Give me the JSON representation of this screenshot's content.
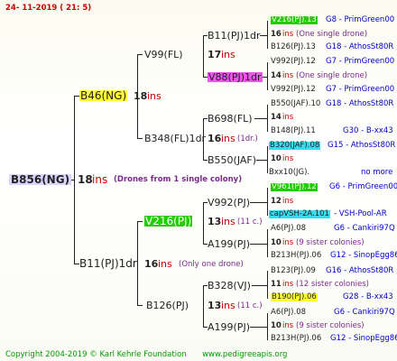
{
  "header": {
    "date": "24- 11-2019 ( 21: 5)"
  },
  "root": {
    "id": "B856(NG)",
    "ins_num": "18",
    "ins_word": "ins",
    "note": "(Drones from 1 single colony)"
  },
  "level1": [
    {
      "id": "B46(NG)",
      "ins_num": "18",
      "ins_word": "ins"
    },
    {
      "id": "B11(PJ)1dr",
      "ins_num": "16",
      "ins_word": "ins",
      "note": "(Only one drone)"
    }
  ],
  "level2": [
    {
      "id": "V99(FL)",
      "ins_num": "17",
      "ins_word": "ins"
    },
    {
      "id": "B348(FL)1dr",
      "ins_num": "16",
      "ins_word": "ins",
      "note": "(1dr.)"
    },
    {
      "id": "V216(PJ)",
      "ins_num": "13",
      "ins_word": "ins",
      "note": "(11 c.)"
    },
    {
      "id": "B126(PJ)",
      "ins_num": "13",
      "ins_word": "ins",
      "note": "(11 c.)"
    }
  ],
  "level3": [
    {
      "id": "B11(PJ)1dr",
      "ins_num": "17",
      "ins_word": "ins"
    },
    {
      "id": "V88(PJ)1dr",
      "ins_num": "",
      "ins_word": ""
    },
    {
      "id": "B698(FL)",
      "ins_num": "14",
      "ins_word": "ins"
    },
    {
      "id": "B550(JAF)",
      "ins_num": "10",
      "ins_word": "ins"
    },
    {
      "id": "V992(PJ)",
      "ins_num": "12",
      "ins_word": "ins"
    },
    {
      "id": "A199(PJ)",
      "ins_num": "10",
      "ins_word": "ins"
    },
    {
      "id": "B328(VJ)",
      "ins_num": "11",
      "ins_word": "ins"
    },
    {
      "id": "A199(PJ)",
      "ins_num": "10",
      "ins_word": "ins"
    }
  ],
  "level4": [
    {
      "id": "V216(PJ).13",
      "right": "G8 - PrimGreen00"
    },
    {
      "id": "16",
      "ins": "ins",
      "note": "(One single drone)"
    },
    {
      "id": "B126(PJ).13",
      "right": "G18 - AthosSt80R"
    },
    {
      "id": "V992(PJ).12",
      "right": "G7 - PrimGreen00"
    },
    {
      "id": "14",
      "ins": "ins",
      "note": "(One single drone)"
    },
    {
      "id": "V992(PJ).12",
      "right": "G7 - PrimGreen00"
    },
    {
      "id": "B550(JAF).10",
      "right": "G18 - AthosSt80R"
    },
    {
      "id": "14",
      "ins": "ins",
      "note": ""
    },
    {
      "id": "B148(PJ).11",
      "right": "G30 - B-xx43"
    },
    {
      "id": "B320(JAF).08",
      "right": "G15 - AthosSt80R"
    },
    {
      "id": "10",
      "ins": "ins",
      "note": ""
    },
    {
      "id": "Bxx10(JG).",
      "right": "no more"
    },
    {
      "id": "V961(PJ).12",
      "right": "G6 - PrimGreen00"
    },
    {
      "id": "12",
      "ins": "ins",
      "note": ""
    },
    {
      "id": "capVSH-2A.101",
      "right": "- VSH-Pool-AR"
    },
    {
      "id": "A6(PJ).08",
      "right": "G6 - Cankiri97Q"
    },
    {
      "id": "10",
      "ins": "ins",
      "note": "(9 sister colonies)"
    },
    {
      "id": "B213H(PJ).06",
      "right": "G12 - SinopEgg86R"
    },
    {
      "id": "B123(PJ).09",
      "right": "G16 - AthosSt80R"
    },
    {
      "id": "11",
      "ins": "ins",
      "note": "(12 sister colonies)"
    },
    {
      "id": "B190(PJ).06",
      "right": "G28 - B-xx43"
    },
    {
      "id": "A6(PJ).08",
      "right": "G6 - Cankiri97Q"
    },
    {
      "id": "10",
      "ins": "ins",
      "note": "(9 sister colonies)"
    },
    {
      "id": "B213H(PJ).06",
      "right": "G12 - SinopEgg86R"
    }
  ],
  "footer": {
    "copyright": "Copyright 2004-2019 © Karl Kehrle Foundation",
    "site": "www.pedigreeapis.org"
  }
}
